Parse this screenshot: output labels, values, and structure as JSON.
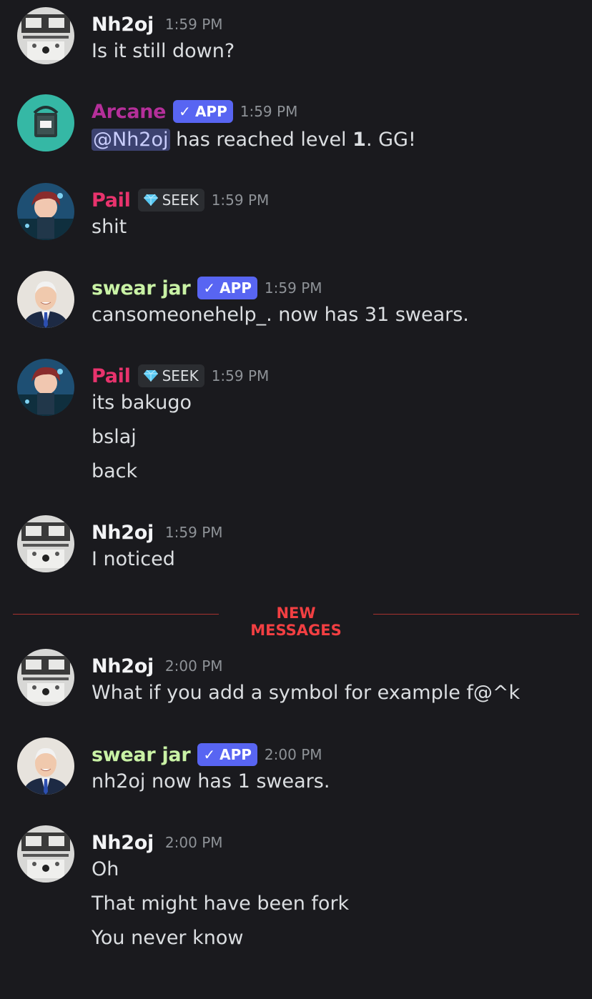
{
  "colors": {
    "background": "#1a1a1e",
    "text": "#dbdee1",
    "timestamp": "#8e9297",
    "app_badge": "#5865f2",
    "new_messages": "#f23f42"
  },
  "app_tag_label": "APP",
  "guild_tag_label": "SEEK",
  "divider_label": "NEW MESSAGES",
  "messages": [
    {
      "author": "Nh2oj",
      "author_color": "#f2f3f5",
      "avatar": "machine-avatar-icon",
      "time": "1:59 PM",
      "lines": [
        "Is it still down?"
      ]
    },
    {
      "author": "Arcane",
      "author_color": "#b52f9a",
      "avatar": "arcane-bucket-avatar-icon",
      "tag": "APP",
      "time": "1:59 PM",
      "mention": "@Nh2oj",
      "text_a": " has reached level ",
      "level": "1",
      "text_b": ". GG!"
    },
    {
      "author": "Pail",
      "author_color": "#e8336d",
      "avatar": "anime-avatar-icon",
      "tag": "SEEK",
      "time": "1:59 PM",
      "lines": [
        "shit"
      ]
    },
    {
      "author": "swear jar",
      "author_color": "#c9f2a5",
      "avatar": "man-portrait-avatar-icon",
      "tag": "APP",
      "time": "1:59 PM",
      "lines": [
        "cansomeonehelp_. now has 31 swears."
      ]
    },
    {
      "author": "Pail",
      "author_color": "#e8336d",
      "avatar": "anime-avatar-icon",
      "tag": "SEEK",
      "time": "1:59 PM",
      "lines": [
        "its bakugo",
        "bslaj",
        "back"
      ]
    },
    {
      "author": "Nh2oj",
      "author_color": "#f2f3f5",
      "avatar": "machine-avatar-icon",
      "time": "1:59 PM",
      "lines": [
        "I noticed"
      ]
    },
    {
      "author": "Nh2oj",
      "author_color": "#f2f3f5",
      "avatar": "machine-avatar-icon",
      "time": "2:00 PM",
      "lines": [
        "What if you add a symbol for example f@^k"
      ]
    },
    {
      "author": "swear jar",
      "author_color": "#c9f2a5",
      "avatar": "man-portrait-avatar-icon",
      "tag": "APP",
      "time": "2:00 PM",
      "lines": [
        "nh2oj now has 1 swears."
      ]
    },
    {
      "author": "Nh2oj",
      "author_color": "#f2f3f5",
      "avatar": "machine-avatar-icon",
      "time": "2:00 PM",
      "lines": [
        "Oh",
        "That might have been fork",
        "You never know"
      ]
    }
  ]
}
